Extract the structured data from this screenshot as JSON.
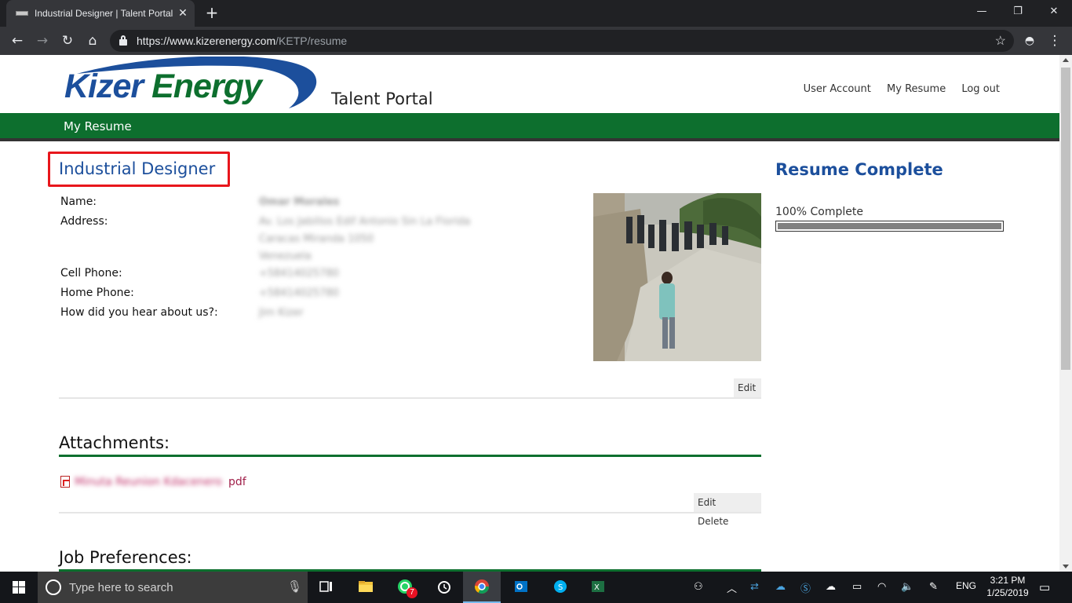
{
  "browser": {
    "tab_title": "Industrial Designer | Talent Portal",
    "url_host": "https://www.kizerenergy.com",
    "url_path": "/KETP/resume"
  },
  "header": {
    "logo_part1": "Kizer",
    "logo_part2": " Energy",
    "portal_title": "Talent Portal",
    "links": [
      "User Account",
      "My Resume",
      "Log out"
    ]
  },
  "nav": {
    "my_resume": "My Resume"
  },
  "profile": {
    "job_title": "Industrial Designer",
    "fields": [
      {
        "label": "Name:",
        "value": "Omar Morales"
      },
      {
        "label": "Address:",
        "value": "Av. Los Jabillos Edif Antonio Sin La Florida"
      },
      {
        "label": "",
        "value": "Caracas Miranda 1050"
      },
      {
        "label": "",
        "value": "Venezuela"
      },
      {
        "label": "Cell Phone:",
        "value": "+58414025780"
      },
      {
        "label": "Home Phone:",
        "value": "+58414025780"
      },
      {
        "label": "How did you hear about us?:",
        "value": "Jim Kizer"
      }
    ],
    "edit_label": "Edit"
  },
  "attachments": {
    "heading": "Attachments:",
    "file_name": "Minuta Reunion Kdacenero",
    "file_ext": "pdf",
    "edit_label": "Edit",
    "delete_label": "Delete"
  },
  "job_preferences": {
    "heading": "Job Preferences:"
  },
  "resume_complete": {
    "heading": "Resume Complete",
    "label": "100% Complete",
    "percent": 100
  },
  "taskbar": {
    "search_placeholder": "Type here to search",
    "whatsapp_badge": "7",
    "lang": "ENG",
    "time": "3:21 PM",
    "date": "1/25/2019"
  },
  "colors": {
    "brand_blue": "#1c4f9c",
    "brand_green": "#0d6f2e",
    "highlight_red": "#e8161c"
  }
}
